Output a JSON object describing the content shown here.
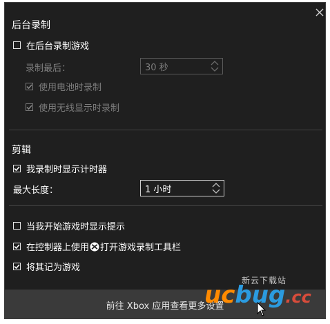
{
  "background_recording": {
    "title": "后台录制",
    "record_in_background": {
      "label": "在后台录制游戏",
      "checked": false
    },
    "record_last": {
      "label": "录制最后：",
      "value": "30 秒",
      "disabled": true
    },
    "use_battery": {
      "label": "使用电池时录制",
      "checked": true,
      "disabled": true
    },
    "use_wireless_display": {
      "label": "使用无线显示时录制",
      "checked": true,
      "disabled": true
    }
  },
  "clips": {
    "title": "剪辑",
    "show_timer": {
      "label": "我录制时显示计时器",
      "checked": true
    },
    "max_length": {
      "label": "最大长度：",
      "value": "1 小时"
    }
  },
  "options": {
    "show_tips": {
      "label": "当我开始游戏时显示提示",
      "checked": false
    },
    "controller": {
      "label_before": "在控制器上使用",
      "label_after": "打开游戏录制工具栏",
      "checked": true,
      "icon": "xbox-icon"
    },
    "remember_game": {
      "label": "将其记为游戏",
      "checked": true
    }
  },
  "footer": {
    "label": "前往 Xbox 应用查看更多设置"
  },
  "watermark": {
    "small": "新云下载站",
    "uc": "uc",
    "bug": "bug",
    "cc": ".cc"
  },
  "colors": {
    "background": "#1f1f1f",
    "footer": "#3a3a3a",
    "text": "#ffffff",
    "disabled": "#7d7d7d",
    "divider": "#444444"
  }
}
